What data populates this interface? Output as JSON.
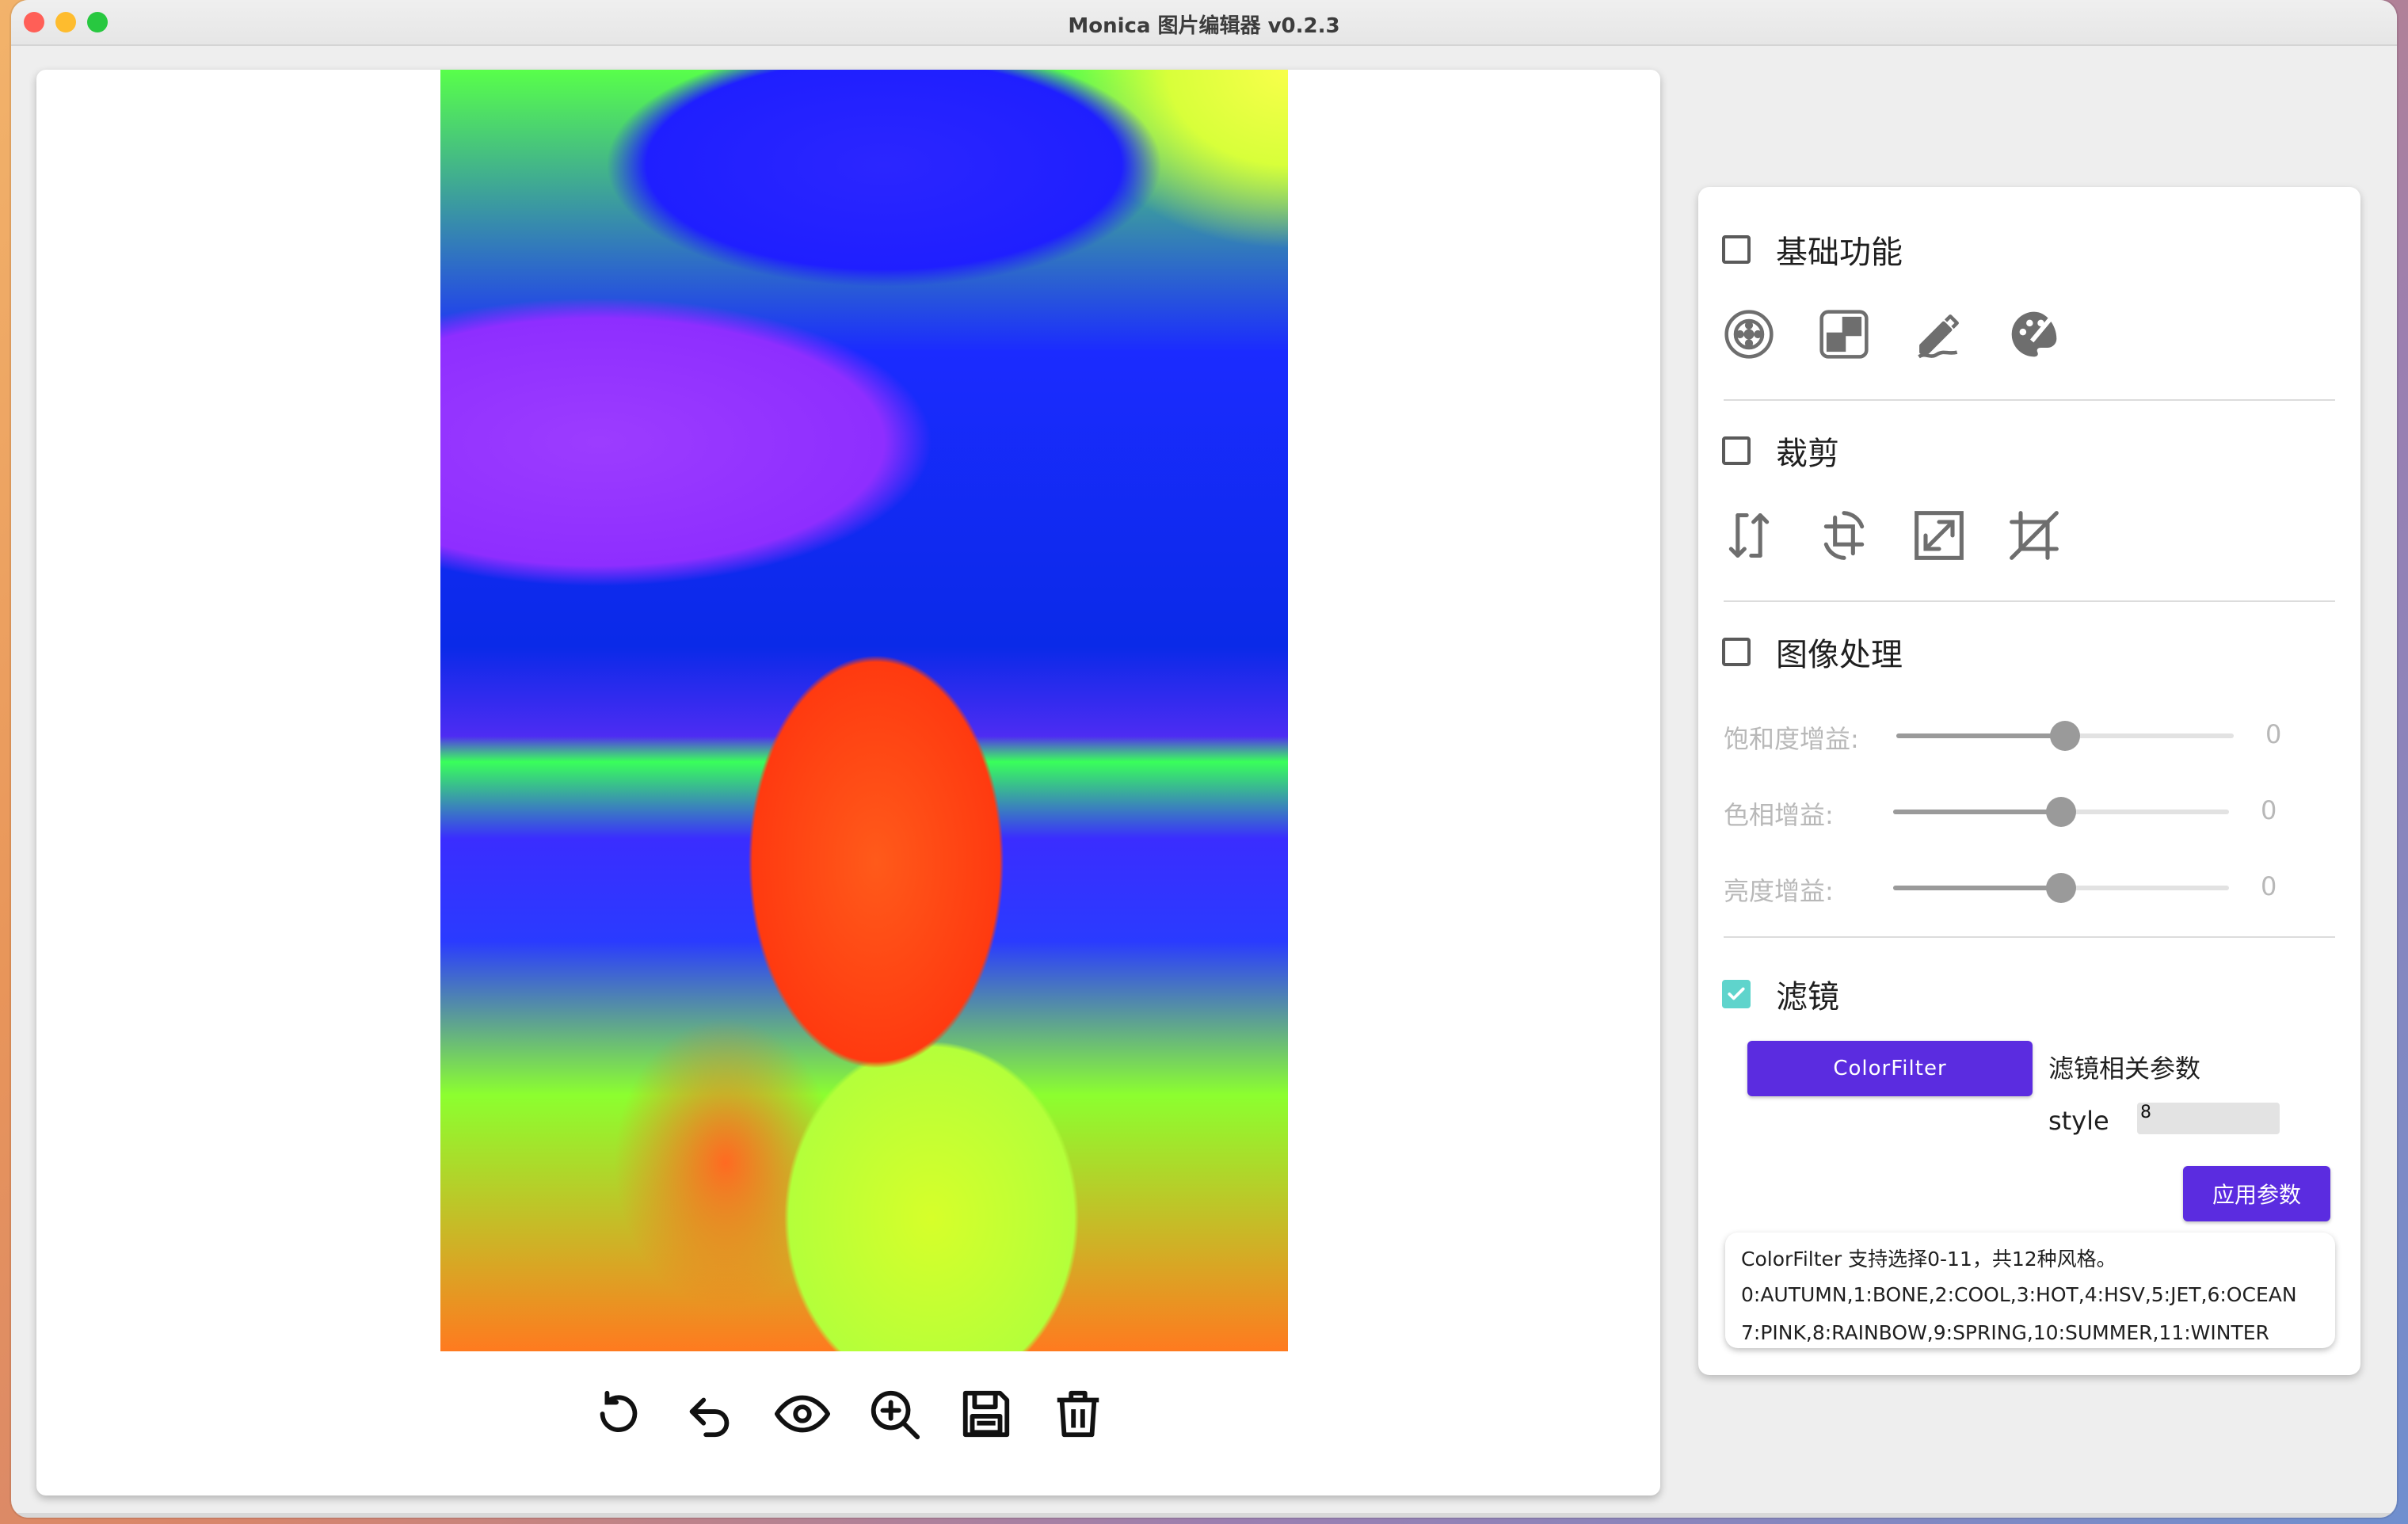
{
  "window": {
    "title": "Monica 图片编辑器 v0.2.3"
  },
  "toolbar": {
    "icons": [
      "rotate-icon",
      "undo-icon",
      "preview-eye-icon",
      "zoom-in-icon",
      "save-icon",
      "delete-icon"
    ]
  },
  "panel": {
    "basic": {
      "title": "基础功能",
      "checked": false,
      "icons": [
        "blur-icon",
        "mosaic-icon",
        "doodle-icon",
        "color-palette-icon"
      ]
    },
    "crop": {
      "title": "裁剪",
      "checked": false,
      "icons": [
        "flip-icon",
        "rotate-crop-icon",
        "resize-icon",
        "crop-icon"
      ]
    },
    "image_processing": {
      "title": "图像处理",
      "checked": false,
      "sliders": [
        {
          "label": "饱和度增益:",
          "value": "0",
          "fraction": 0.5
        },
        {
          "label": "色相增益:",
          "value": "0",
          "fraction": 0.5
        },
        {
          "label": "亮度增益:",
          "value": "0",
          "fraction": 0.5
        }
      ]
    },
    "filter": {
      "title": "滤镜",
      "checked": true,
      "button_label": "ColorFilter",
      "params_title": "滤镜相关参数",
      "style_label": "style",
      "style_value": "8",
      "apply_label": "应用参数"
    }
  },
  "info": {
    "lines": [
      "ColorFilter 支持选择0-11，共12种风格。",
      "0:AUTUMN,1:BONE,2:COOL,3:HOT,4:HSV,5:JET,6:OCEAN",
      "7:PINK,8:RAINBOW,9:SPRING,10:SUMMER,11:WINTER"
    ]
  },
  "colors": {
    "accent": "#5b2ce0",
    "check": "#5fd4cc"
  }
}
